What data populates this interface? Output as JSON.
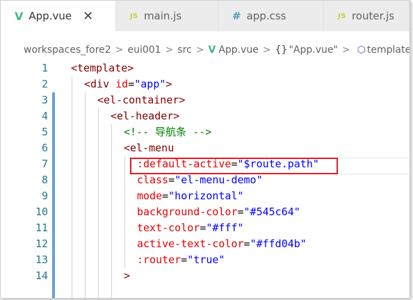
{
  "tabs": [
    {
      "icon": "V",
      "icon_name": "vue-file-icon",
      "label": "App.vue",
      "active": true,
      "close": "✕"
    },
    {
      "icon": "JS",
      "icon_name": "js-file-icon",
      "label": "main.js",
      "active": false
    },
    {
      "icon": "#",
      "icon_name": "css-file-icon",
      "label": "app.css",
      "active": false
    },
    {
      "icon": "JS",
      "icon_name": "js-file-icon",
      "label": "router.js",
      "active": false
    }
  ],
  "breadcrumb": {
    "workspace": "workspaces_fore2",
    "project": "eui001",
    "folder": "src",
    "file_icon": "V",
    "file": "App.vue",
    "symbol_brace": "{}",
    "symbol": "\"App.vue\"",
    "template_icon": "⬡",
    "template": "template",
    "separator": ">"
  },
  "code_lines": [
    {
      "num": "1"
    },
    {
      "num": "2"
    },
    {
      "num": "3"
    },
    {
      "num": "4"
    },
    {
      "num": "5"
    },
    {
      "num": "6"
    },
    {
      "num": "7"
    },
    {
      "num": "8"
    },
    {
      "num": "9"
    },
    {
      "num": "10"
    },
    {
      "num": "11"
    },
    {
      "num": "12"
    },
    {
      "num": "13"
    },
    {
      "num": "14"
    }
  ],
  "code": {
    "l1_tag": "<template>",
    "l2_tag_open": "<div ",
    "l2_attr": "id",
    "l2_eq": "=",
    "l2_val": "\"app\"",
    "l2_tag_close": ">",
    "l3_tag": "<el-container>",
    "l4_tag": "<el-header>",
    "l5_comment": "<!-- 导航条 -->",
    "l6_tag": "<el-menu",
    "l7_attr": ":default-active",
    "l7_eq": "=",
    "l7_val": "\"$route.path\"",
    "l8_attr": "class",
    "l8_eq": "=",
    "l8_val": "\"el-menu-demo\"",
    "l9_attr": "mode",
    "l9_eq": "=",
    "l9_val": "\"horizontal\"",
    "l10_attr": "background-color",
    "l10_eq": "=",
    "l10_val": "\"#545c64\"",
    "l11_attr": "text-color",
    "l11_eq": "=",
    "l11_val": "\"#fff\"",
    "l12_attr": "active-text-color",
    "l12_eq": "=",
    "l12_val": "\"#ffd04b\"",
    "l13_attr": ":router",
    "l13_eq": "=",
    "l13_val": "\"true\"",
    "l14_tag": ">"
  },
  "colors": {
    "tag": "#800000",
    "attribute": "#e50000",
    "string": "#0000ff",
    "comment": "#008000",
    "line_number": "#237893",
    "highlight_box": "#e01b24"
  }
}
